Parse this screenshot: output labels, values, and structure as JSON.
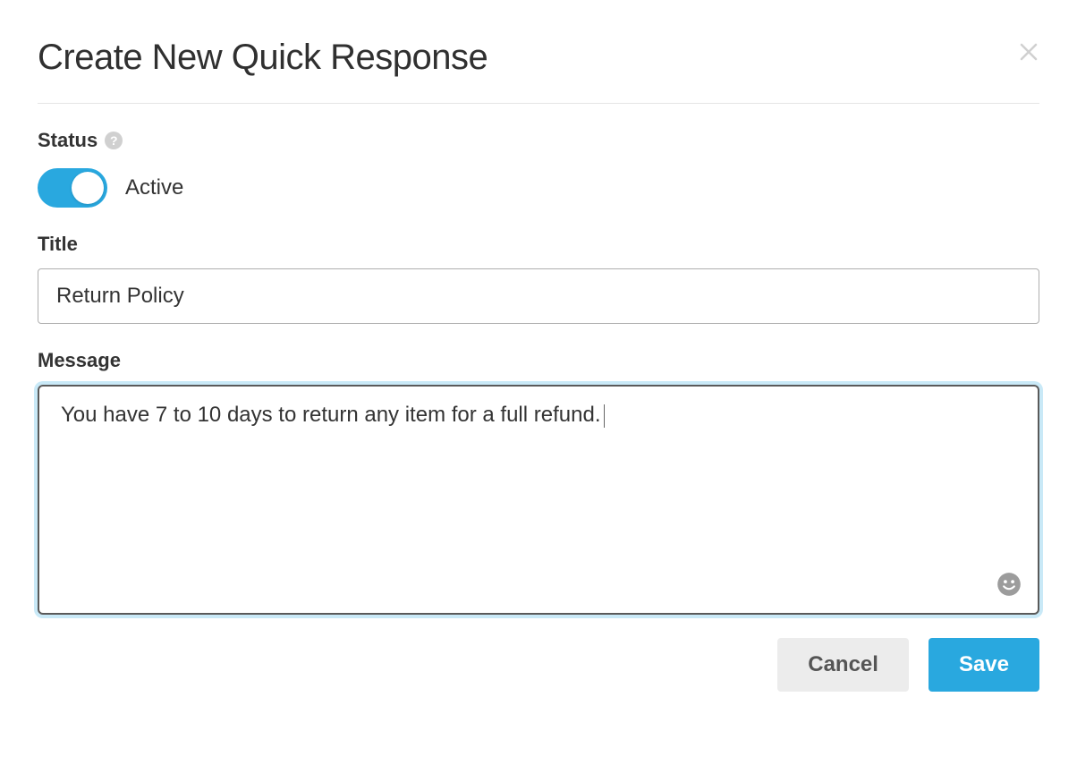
{
  "dialog": {
    "title": "Create New Quick Response"
  },
  "status": {
    "label": "Status",
    "toggle_label": "Active",
    "active": true
  },
  "title_field": {
    "label": "Title",
    "value": "Return Policy"
  },
  "message_field": {
    "label": "Message",
    "value": "You have 7 to 10 days to return any item for a full refund."
  },
  "buttons": {
    "cancel": "Cancel",
    "save": "Save"
  }
}
